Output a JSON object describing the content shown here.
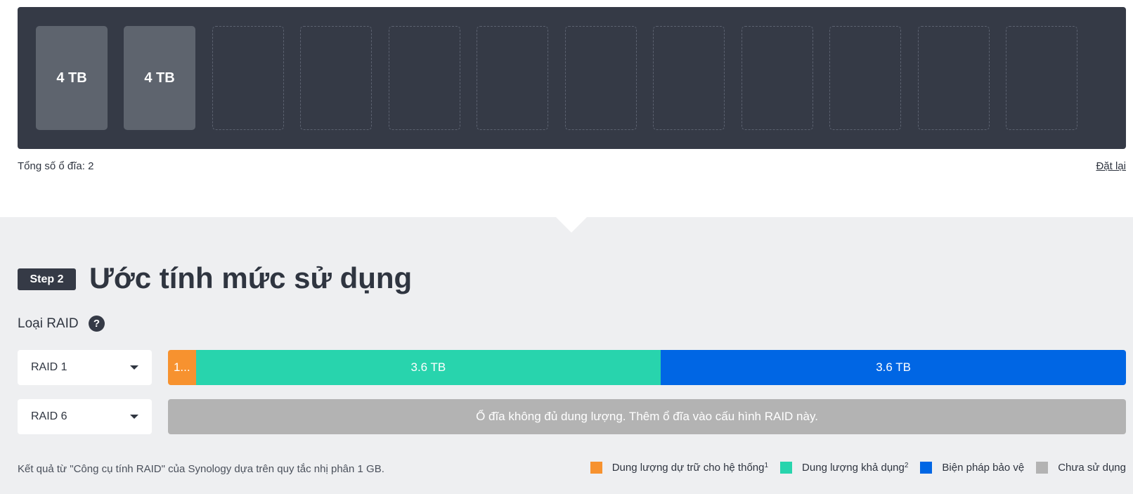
{
  "drive_bay": {
    "slots": [
      {
        "filled": true,
        "label": "4 TB"
      },
      {
        "filled": true,
        "label": "4 TB"
      },
      {
        "filled": false,
        "label": ""
      },
      {
        "filled": false,
        "label": ""
      },
      {
        "filled": false,
        "label": ""
      },
      {
        "filled": false,
        "label": ""
      },
      {
        "filled": false,
        "label": ""
      },
      {
        "filled": false,
        "label": ""
      },
      {
        "filled": false,
        "label": ""
      },
      {
        "filled": false,
        "label": ""
      },
      {
        "filled": false,
        "label": ""
      },
      {
        "filled": false,
        "label": ""
      }
    ],
    "total_label": "Tổng số ổ đĩa: 2",
    "reset_label": "Đặt lại"
  },
  "step": {
    "badge": "Step 2",
    "title": "Ước tính mức sử dụng"
  },
  "raid": {
    "label": "Loại RAID",
    "help_icon": "?",
    "rows": [
      {
        "selected": "RAID 1",
        "segments": [
          {
            "type": "reserved",
            "label": "1...",
            "fraction": 0.029
          },
          {
            "type": "available",
            "label": "3.6 TB",
            "fraction": 0.4855
          },
          {
            "type": "protection",
            "label": "3.6 TB",
            "fraction": 0.4855
          }
        ]
      },
      {
        "selected": "RAID 6",
        "message": "Ổ đĩa không đủ dung lượng. Thêm ổ đĩa vào cấu hình RAID này."
      }
    ]
  },
  "footer": {
    "note": "Kết quả từ \"Công cụ tính RAID\" của Synology dựa trên quy tắc nhị phân 1 GB.",
    "legend": [
      {
        "label": "Dung lượng dự trữ cho hệ thống",
        "sup": "1",
        "color": "#f7922f"
      },
      {
        "label": "Dung lượng khả dụng",
        "sup": "2",
        "color": "#28d4ad"
      },
      {
        "label": "Biện pháp bảo vệ",
        "sup": "",
        "color": "#0066e4"
      },
      {
        "label": "Chưa sử dụng",
        "sup": "",
        "color": "#b3b3b3"
      }
    ]
  }
}
